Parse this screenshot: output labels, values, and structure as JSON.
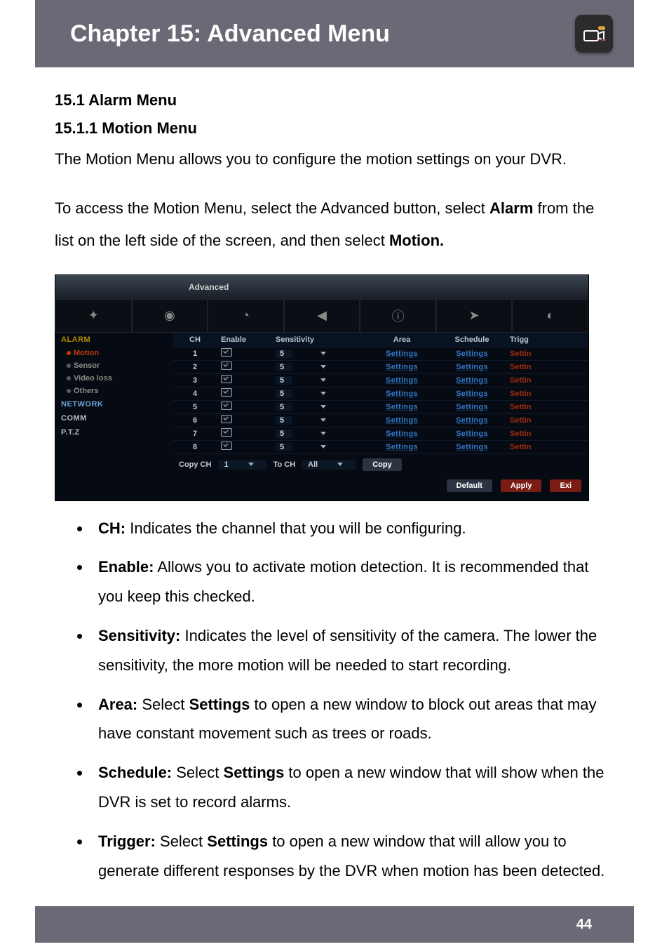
{
  "header": {
    "title": "Chapter 15: Advanced Menu"
  },
  "section": {
    "h1": "15.1 Alarm Menu",
    "h2": "15.1.1 Motion Menu",
    "p1": "The Motion Menu allows you to configure the motion settings on your DVR.",
    "p2_a": "To access the Motion Menu, select the Advanced button, select ",
    "p2_b": "Alarm",
    "p2_c": " from the list on the left side of the screen, and then select ",
    "p2_d": "Motion."
  },
  "screenshot": {
    "windowTitle": "Advanced",
    "sidebar": {
      "group1": "ALARM",
      "items1": [
        "Motion",
        "Sensor",
        "Video loss",
        "Others"
      ],
      "group2": "NETWORK",
      "group3": "COMM",
      "group4": "P.T.Z"
    },
    "table": {
      "headers": [
        "CH",
        "Enable",
        "Sensitivity",
        "Area",
        "Schedule",
        "Trigg"
      ],
      "rows": [
        {
          "ch": "1",
          "sens": "5",
          "area": "Settings",
          "sched": "Settings",
          "trg": "Settin"
        },
        {
          "ch": "2",
          "sens": "5",
          "area": "Settings",
          "sched": "Settings",
          "trg": "Settin"
        },
        {
          "ch": "3",
          "sens": "5",
          "area": "Settings",
          "sched": "Settings",
          "trg": "Settin"
        },
        {
          "ch": "4",
          "sens": "5",
          "area": "Settings",
          "sched": "Settings",
          "trg": "Settin"
        },
        {
          "ch": "5",
          "sens": "5",
          "area": "Settings",
          "sched": "Settings",
          "trg": "Settin"
        },
        {
          "ch": "6",
          "sens": "5",
          "area": "Settings",
          "sched": "Settings",
          "trg": "Settin"
        },
        {
          "ch": "7",
          "sens": "5",
          "area": "Settings",
          "sched": "Settings",
          "trg": "Settin"
        },
        {
          "ch": "8",
          "sens": "5",
          "area": "Settings",
          "sched": "Settings",
          "trg": "Settin"
        }
      ]
    },
    "copyRow": {
      "label1": "Copy CH",
      "val1": "1",
      "label2": "To CH",
      "val2": "All",
      "copyBtn": "Copy"
    },
    "buttons": {
      "default": "Default",
      "apply": "Apply",
      "exit": "Exi"
    }
  },
  "bullets": [
    {
      "term": "CH:",
      "text": " Indicates the channel that you will be configuring."
    },
    {
      "term": "Enable:",
      "text": " Allows you to activate motion detection. It is recommended that you keep this checked."
    },
    {
      "term": "Sensitivity:",
      "text": " Indicates the level of sensitivity of the camera. The lower the sensitivity, the more motion will be needed to start recording."
    },
    {
      "term": "Area:",
      "mid_a": " Select ",
      "mid_b": "Settings",
      "text": " to open a new window to block out areas that may have constant movement such as trees or roads."
    },
    {
      "term": "Schedule:",
      "mid_a": " Select ",
      "mid_b": "Settings",
      "text": " to open a new window that will show when the DVR is set to record alarms."
    },
    {
      "term": "Trigger:",
      "mid_a": " Select ",
      "mid_b": "Settings",
      "text": " to open a new window that will allow you to generate different responses by the DVR when motion has been detected."
    }
  ],
  "footer": {
    "page": "44"
  }
}
